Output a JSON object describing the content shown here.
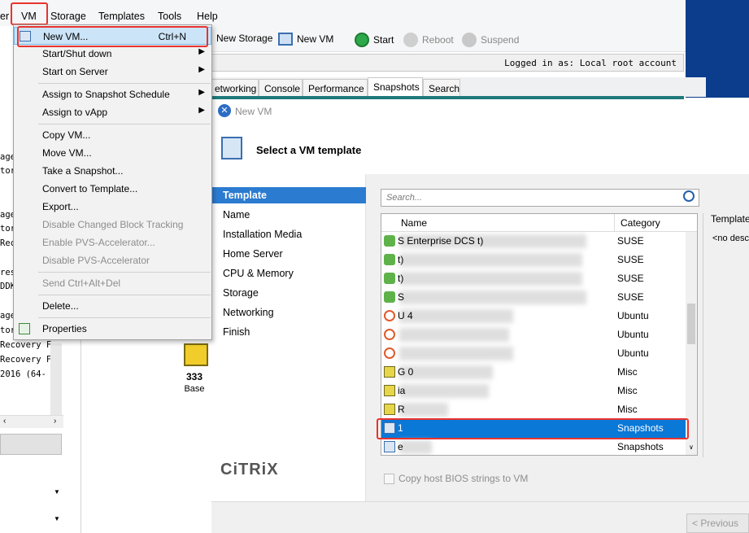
{
  "menubar": {
    "items": [
      "er",
      "VM",
      "Storage",
      "Templates",
      "Tools",
      "Help"
    ]
  },
  "toolbar": {
    "new_storage": "New Storage",
    "new_vm": "New VM",
    "start": "Start",
    "reboot": "Reboot",
    "suspend": "Suspend"
  },
  "status": {
    "logged_in": "Logged in as: Local root account"
  },
  "tabs": [
    "etworking",
    "Console",
    "Performance",
    "Snapshots",
    "Search"
  ],
  "vm_menu": {
    "items": [
      {
        "label": "New VM...",
        "shortcut": "Ctrl+N"
      },
      {
        "label": "Start/Shut down"
      },
      {
        "label": "Start on Server"
      },
      {
        "label": "Assign to Snapshot Schedule"
      },
      {
        "label": "Assign to vApp"
      },
      {
        "label": "Copy VM..."
      },
      {
        "label": "Move VM..."
      },
      {
        "label": "Take a Snapshot..."
      },
      {
        "label": "Convert to Template..."
      },
      {
        "label": "Export..."
      },
      {
        "label": "Disable Changed Block Tracking"
      },
      {
        "label": "Enable PVS-Accelerator..."
      },
      {
        "label": "Disable PVS-Accelerator"
      },
      {
        "label": "Send Ctrl+Alt+Del"
      },
      {
        "label": "Delete..."
      },
      {
        "label": "Properties"
      }
    ]
  },
  "left_tree": {
    "lines": [
      "age",
      "tor",
      "age",
      "tor",
      "Rec",
      "res",
      "DDK",
      "age",
      "tor",
      "Recovery F",
      "Recovery F",
      "2016 (64-"
    ]
  },
  "background_vm": {
    "name": "333",
    "subtitle": "Base"
  },
  "dialog": {
    "title": "New VM",
    "heading": "Select a VM template",
    "steps": [
      "Template",
      "Name",
      "Installation Media",
      "Home Server",
      "CPU & Memory",
      "Storage",
      "Networking",
      "Finish"
    ],
    "search_placeholder": "Search...",
    "columns": {
      "name": "Name",
      "category": "Category"
    },
    "rows": [
      {
        "name": "S         Enterprise DCS     t)",
        "category": "SUSE"
      },
      {
        "name": "                            t)",
        "category": "SUSE"
      },
      {
        "name": "                            t)",
        "category": "SUSE"
      },
      {
        "name": "S",
        "category": "SUSE"
      },
      {
        "name": "U                   4",
        "category": "Ubuntu"
      },
      {
        "name": "",
        "category": "Ubuntu"
      },
      {
        "name": "",
        "category": "Ubuntu"
      },
      {
        "name": "G                0",
        "category": "Misc"
      },
      {
        "name": "             ia",
        "category": "Misc"
      },
      {
        "name": "R",
        "category": "Misc"
      },
      {
        "name": "1",
        "category": "Snapshots"
      },
      {
        "name": "       e",
        "category": "Snapshots"
      }
    ],
    "side_label": "Template",
    "side_value": "<no desc",
    "copy_bios": "Copy host BIOS strings to VM",
    "brand": "CiTRiX",
    "prev_button": "< Previous"
  }
}
